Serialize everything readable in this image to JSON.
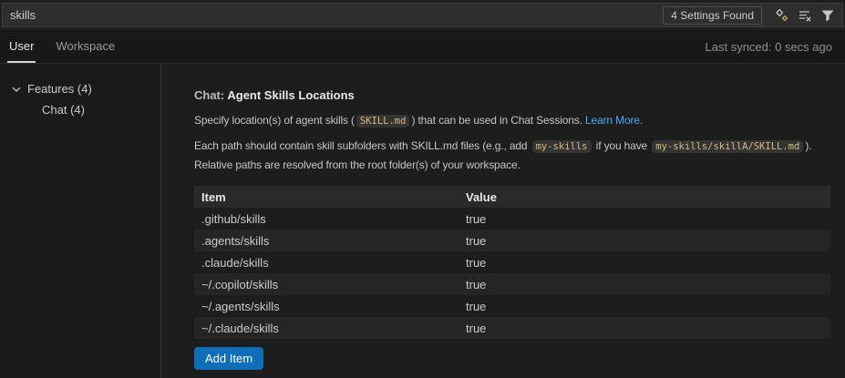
{
  "colors": {
    "accent": "#0e6fb8",
    "link": "#4daafc",
    "code-text": "#d7ba7d"
  },
  "search": {
    "value": "skills",
    "results_badge": "4 Settings Found",
    "action_icons": [
      "ai-search",
      "clear-search-results",
      "filter-settings"
    ]
  },
  "tabs": {
    "user": "User",
    "workspace": "Workspace",
    "last_synced": "Last synced: 0 secs ago"
  },
  "toc": {
    "features": "Features (4)",
    "chat": "Chat (4)"
  },
  "setting": {
    "category": "Chat: ",
    "title": "Agent Skills Locations",
    "desc1": {
      "pre": "Specify location(s) of agent skills (",
      "code": "SKILL.md",
      "post": ") that can be used in Chat Sessions. ",
      "link": "Learn More."
    },
    "desc2": {
      "pre": "Each path should contain skill subfolders with SKILL.md files (e.g., add ",
      "code1": "my-skills",
      "mid": " if you have ",
      "code2": "my-skills/skillA/SKILL.md",
      "post": ").",
      "line2": "Relative paths are resolved from the root folder(s) of your workspace."
    },
    "table": {
      "headers": [
        "Item",
        "Value"
      ],
      "rows": [
        {
          "item": ".github/skills",
          "value": "true"
        },
        {
          "item": ".agents/skills",
          "value": "true"
        },
        {
          "item": ".claude/skills",
          "value": "true"
        },
        {
          "item": "~/.copilot/skills",
          "value": "true"
        },
        {
          "item": "~/.agents/skills",
          "value": "true"
        },
        {
          "item": "~/.claude/skills",
          "value": "true"
        }
      ]
    },
    "add_button": "Add Item"
  }
}
